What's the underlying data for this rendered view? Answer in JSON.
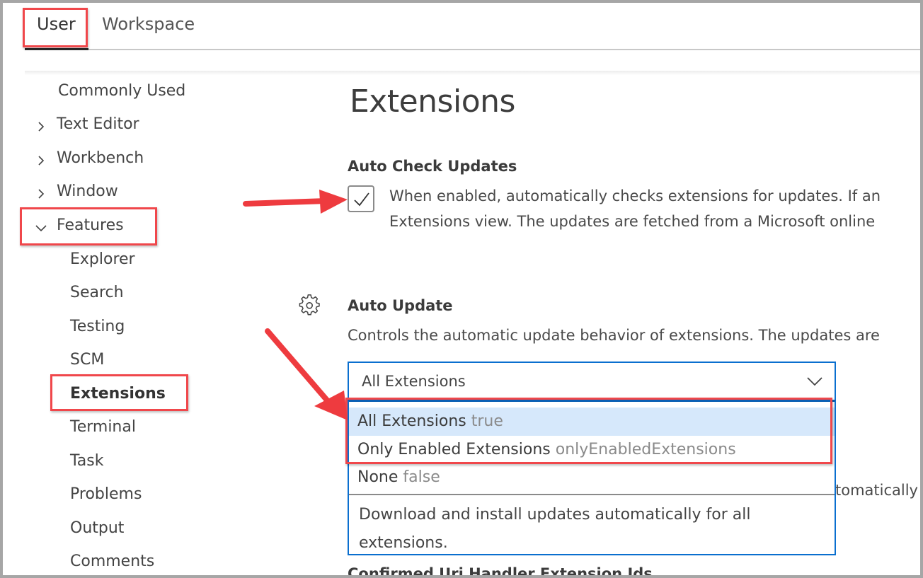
{
  "tabs": [
    {
      "label": "User",
      "active": true
    },
    {
      "label": "Workspace",
      "active": false
    }
  ],
  "sidebar": {
    "items": [
      {
        "label": "Commonly Used",
        "chevron": "none",
        "level": 0
      },
      {
        "label": "Text Editor",
        "chevron": "right",
        "level": 0
      },
      {
        "label": "Workbench",
        "chevron": "right",
        "level": 0
      },
      {
        "label": "Window",
        "chevron": "right",
        "level": 0
      },
      {
        "label": "Features",
        "chevron": "down",
        "level": 0
      },
      {
        "label": "Explorer",
        "level": 1
      },
      {
        "label": "Search",
        "level": 1
      },
      {
        "label": "Testing",
        "level": 1
      },
      {
        "label": "SCM",
        "level": 1
      },
      {
        "label": "Extensions",
        "level": 1,
        "active": true
      },
      {
        "label": "Terminal",
        "level": 1
      },
      {
        "label": "Task",
        "level": 1
      },
      {
        "label": "Problems",
        "level": 1
      },
      {
        "label": "Output",
        "level": 1
      },
      {
        "label": "Comments",
        "level": 1
      }
    ]
  },
  "main": {
    "title": "Extensions",
    "settings": {
      "auto_check_updates": {
        "title": "Auto Check Updates",
        "checked": true,
        "description_line1": "When enabled, automatically checks extensions for updates. If an",
        "description_line2": "Extensions view. The updates are fetched from a Microsoft online"
      },
      "auto_update": {
        "title": "Auto Update",
        "gear_icon": "gear-icon",
        "description": "Controls the automatic update behavior of extensions. The updates are",
        "selected_value": "All Extensions",
        "options": [
          {
            "label": "All Extensions",
            "value": "true",
            "highlighted": true
          },
          {
            "label": "Only Enabled Extensions",
            "value": "onlyEnabledExtensions",
            "highlighted": false
          },
          {
            "label": "None",
            "value": "false",
            "highlighted": false
          }
        ],
        "option_description": "Download and install updates automatically for all extensions.",
        "behind_text": "tomatically"
      },
      "next_setting_title": "Confirmed Uri Handler Extension Ids"
    }
  },
  "colors": {
    "annotation": "#f0474b",
    "focus_border": "#0a6fcf",
    "option_highlight": "#d6e8fb"
  }
}
